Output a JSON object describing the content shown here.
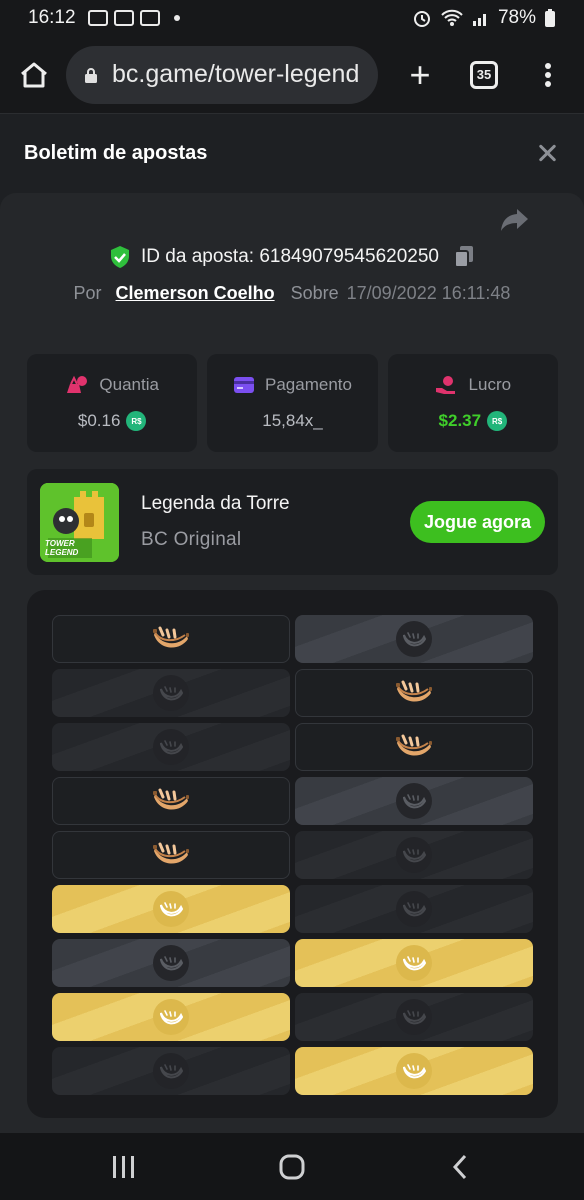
{
  "status_bar": {
    "time": "16:12",
    "battery": "78%"
  },
  "browser": {
    "url": "bc.game/tower-legend",
    "tab_count": "35",
    "new_tab_label": "+"
  },
  "modal": {
    "title": "Boletim de apostas"
  },
  "bet": {
    "id_label": "ID da aposta: 61849079545620250",
    "by_label": "Por",
    "player": "Clemerson Coelho",
    "on_label": "Sobre",
    "datetime": "17/09/2022 16:11:48"
  },
  "stats": {
    "amount": {
      "label": "Quantia",
      "value": "$0.16",
      "coin": "R$"
    },
    "payout": {
      "label": "Pagamento",
      "value": "15,84x_"
    },
    "profit": {
      "label": "Lucro",
      "value": "$2.37",
      "coin": "R$"
    }
  },
  "game": {
    "name": "Legenda da Torre",
    "provider": "BC Original",
    "thumb_text": "TOWER LEGEND",
    "play_button": "Jogue agora"
  },
  "tower": {
    "rows": [
      [
        "banana",
        "grey"
      ],
      [
        "dark",
        "banana"
      ],
      [
        "dark",
        "banana"
      ],
      [
        "banana",
        "grey"
      ],
      [
        "banana",
        "dark"
      ],
      [
        "gold",
        "dark"
      ],
      [
        "grey",
        "gold"
      ],
      [
        "gold",
        "dark"
      ],
      [
        "dark",
        "gold"
      ]
    ]
  },
  "colors": {
    "accent_green": "#3dbf1f",
    "profit_green": "#3fcf2a",
    "gold_tile": "#e4c158"
  }
}
